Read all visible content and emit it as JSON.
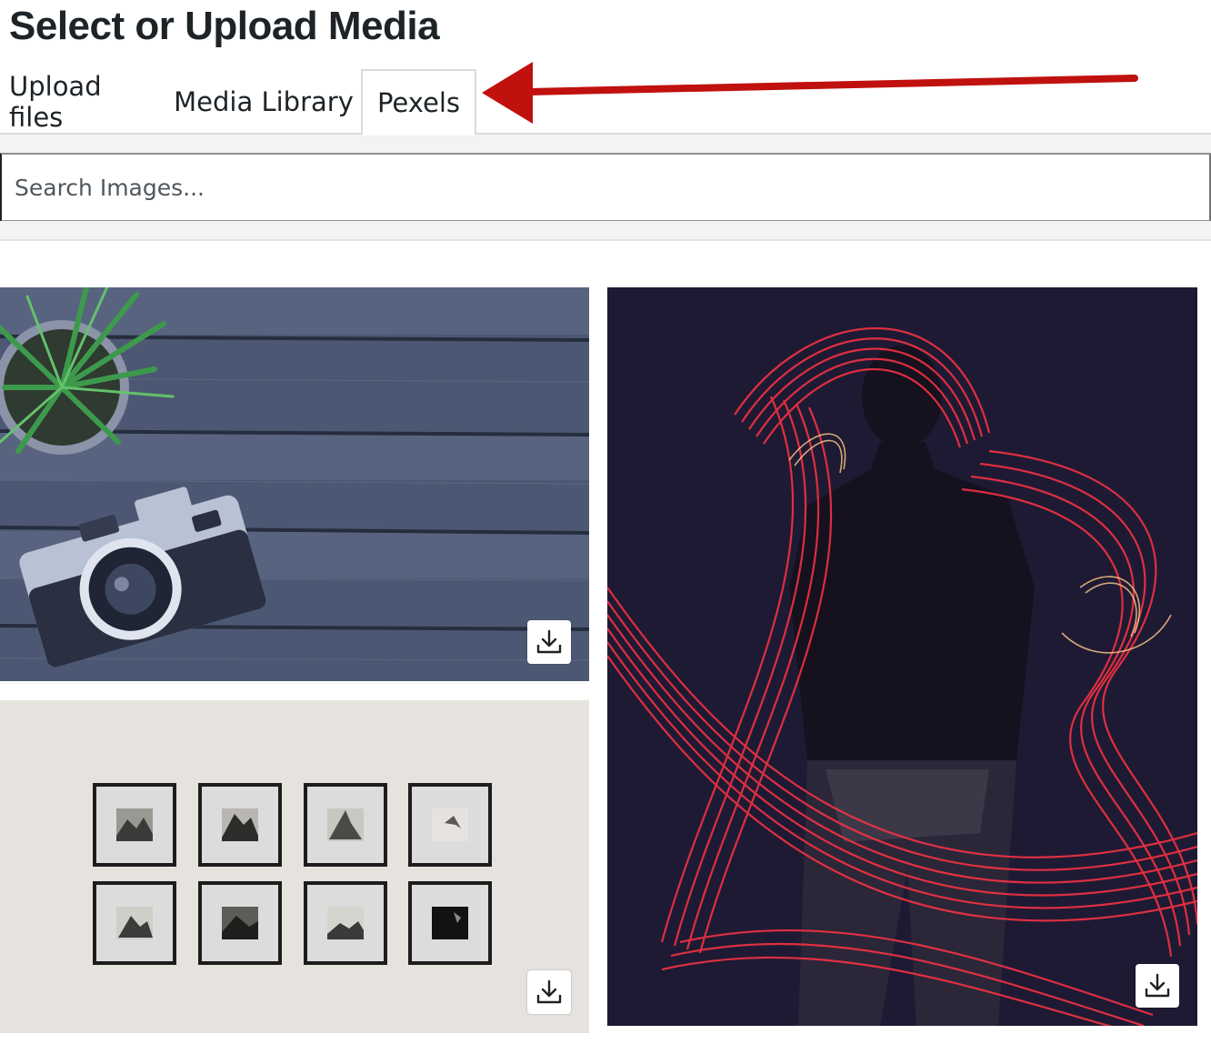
{
  "header": {
    "title": "Select or Upload Media"
  },
  "tabs": [
    {
      "label": "Upload files",
      "active": false
    },
    {
      "label": "Media Library",
      "active": false
    },
    {
      "label": "Pexels",
      "active": true
    }
  ],
  "search": {
    "placeholder": "Search Images..."
  },
  "gallery": {
    "images": [
      {
        "subject": "vintage camera and potted plant on wooden table",
        "icon": "download-icon"
      },
      {
        "subject": "eight framed mountain photos on a wall",
        "icon": "download-icon"
      },
      {
        "subject": "silhouette surrounded by red light trails",
        "icon": "download-icon"
      }
    ]
  },
  "annotation": {
    "arrow_color": "#c0110f"
  },
  "colors": {
    "tab_border": "#dcdcde",
    "search_border": "#8c8f94",
    "text": "#1d2327"
  }
}
